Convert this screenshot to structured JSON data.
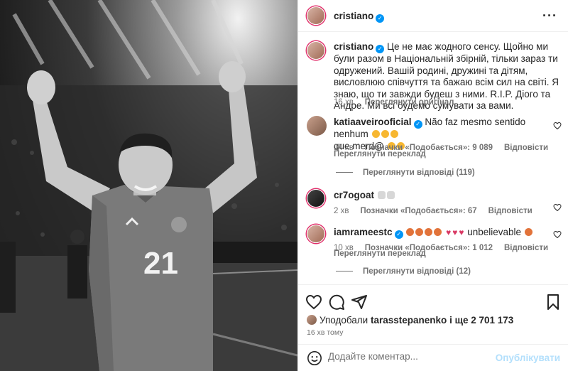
{
  "post": {
    "author": "cristiano",
    "photo_number": "21"
  },
  "caption": {
    "username": "cristiano",
    "text": "Це не має жодного сенсу. Щойно ми були разом в Національній збірній, тільки зараз ти одружений. Вашій родині, дружині та дітям, висловлюю співчуття та бажаю всім сил на світі. Я знаю, що ти завжди будеш з ними. R.I.P. Діого та Андре. Ми всі будемо сумувати за вами.",
    "time": "16 хв",
    "see_original": "Переглянути оригінал"
  },
  "comments": [
    {
      "username": "katiaaveirooficial",
      "verified": true,
      "text": "Não faz mesmo sentido nenhum",
      "text_tail": "que merd@",
      "time": "14 хв",
      "likes": "Позначки «Подобається»: 9 089",
      "reply": "Відповісти",
      "translate": "Переглянути переклад",
      "view_replies": "Переглянути відповіді (119)"
    },
    {
      "username": "cr7ogoat",
      "verified": false,
      "text": "",
      "time": "2 хв",
      "likes": "Позначки «Подобається»: 67",
      "reply": "Відповісти"
    },
    {
      "username": "iamrameestc",
      "verified": true,
      "text": "unbelievable",
      "time": "10 хв",
      "likes": "Позначки «Подобається»: 1 012",
      "reply": "Відповісти",
      "translate": "Переглянути переклад",
      "view_replies": "Переглянути відповіді (12)"
    }
  ],
  "likes_summary": {
    "prefix": "Уподобали",
    "user": "tarasstepanenko",
    "suffix": "і ще 2 701 173"
  },
  "posted_ago": "16 хв тому",
  "composer": {
    "placeholder": "Додайте коментар...",
    "post_label": "Опублікувати"
  },
  "colors": {
    "verified": "#0095f6",
    "post_button_disabled": "#b2dffc",
    "story_ring": "#e1306c"
  },
  "icons": [
    "more-options-icon",
    "heart-icon",
    "comment-icon",
    "share-icon",
    "bookmark-icon",
    "emoji-icon"
  ]
}
